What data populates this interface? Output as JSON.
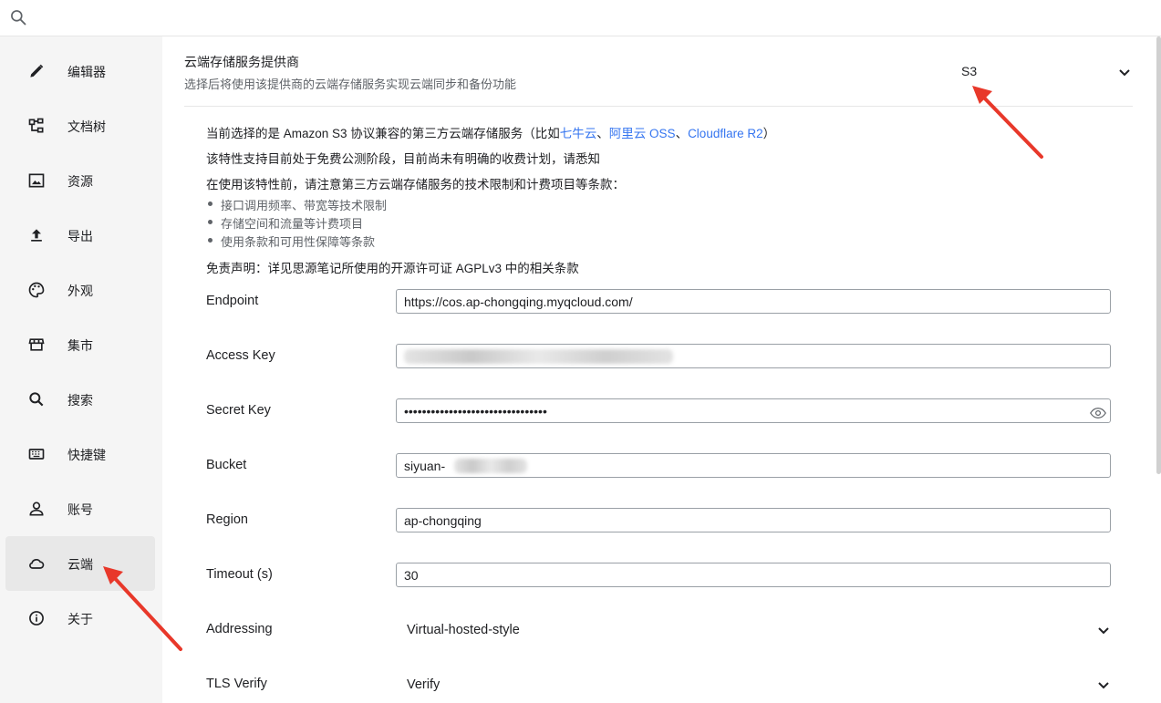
{
  "sidebar": {
    "items": [
      {
        "label": "编辑器",
        "icon": "pencil-icon"
      },
      {
        "label": "文档树",
        "icon": "tree-icon"
      },
      {
        "label": "资源",
        "icon": "image-icon"
      },
      {
        "label": "导出",
        "icon": "upload-icon"
      },
      {
        "label": "外观",
        "icon": "palette-icon"
      },
      {
        "label": "集市",
        "icon": "store-icon"
      },
      {
        "label": "搜索",
        "icon": "search-icon"
      },
      {
        "label": "快捷键",
        "icon": "keyboard-icon"
      },
      {
        "label": "账号",
        "icon": "user-icon"
      },
      {
        "label": "云端",
        "icon": "cloud-icon"
      },
      {
        "label": "关于",
        "icon": "info-icon"
      }
    ],
    "active": "云端"
  },
  "provider": {
    "title": "云端存储服务提供商",
    "description": "选择后将使用该提供商的云端存储服务实现云端同步和备份功能",
    "selected": "S3"
  },
  "info": {
    "line1_prefix": "当前选择的是 Amazon S3 协议兼容的第三方云端存储服务（比如",
    "link1": "七牛云",
    "sep1": "、",
    "link2": "阿里云 OSS",
    "sep2": "、",
    "link3": "Cloudflare R2",
    "line1_suffix": "）",
    "line2": "该特性支持目前处于免费公测阶段，目前尚未有明确的收费计划，请悉知",
    "line3": "在使用该特性前，请注意第三方云端存储服务的技术限制和计费项目等条款：",
    "bullets": [
      "接口调用频率、带宽等技术限制",
      "存储空间和流量等计费项目",
      "使用条款和可用性保障等条款"
    ],
    "disclaimer": "免责声明：详见思源笔记所使用的开源许可证 AGPLv3 中的相关条款"
  },
  "fields": {
    "endpoint": {
      "label": "Endpoint",
      "value": "https://cos.ap-chongqing.myqcloud.com/"
    },
    "access_key": {
      "label": "Access Key",
      "value": ""
    },
    "secret_key": {
      "label": "Secret Key",
      "value": "••••••••••••••••••••••••••••••••"
    },
    "bucket": {
      "label": "Bucket",
      "value": "siyuan-"
    },
    "region": {
      "label": "Region",
      "value": "ap-chongqing"
    },
    "timeout": {
      "label": "Timeout (s)",
      "value": "30"
    },
    "addressing": {
      "label": "Addressing",
      "value": "Virtual-hosted-style"
    },
    "tls_verify": {
      "label": "TLS Verify",
      "value": "Verify"
    }
  },
  "colors": {
    "link": "#3575f0",
    "annotation_arrow": "#e8382a"
  }
}
